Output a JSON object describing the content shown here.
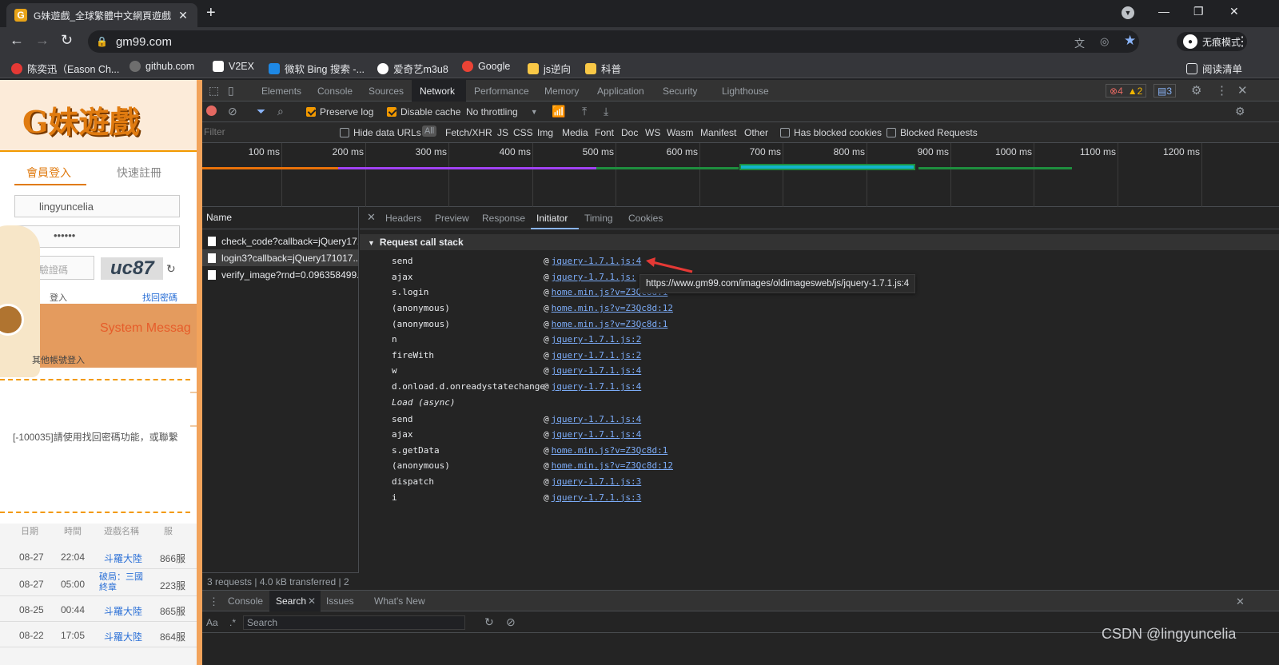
{
  "browser": {
    "tab_title": "G妹遊戲_全球繁體中文網頁遊戲",
    "tab_favicon": "G",
    "url": "gm99.com",
    "incognito_label": "无痕模式",
    "bookmarks": [
      {
        "label": "陈奕迅（Eason Ch...",
        "color": "#e53935"
      },
      {
        "label": "github.com",
        "color": "#6e6e6e"
      },
      {
        "label": "V2EX",
        "color": "#ffffff"
      },
      {
        "label": "微软 Bing 搜索 -...",
        "color": "#1e88e5"
      },
      {
        "label": "爱奇艺m3u8",
        "color": "#ffffff"
      },
      {
        "label": "Google",
        "color": "#ea4335"
      },
      {
        "label": "js逆向",
        "color": "#f9c846"
      },
      {
        "label": "科普",
        "color": "#f9c846"
      }
    ],
    "reading_list": "阅读清单"
  },
  "site": {
    "logo": "G妹遊戲",
    "login_tab": "會員登入",
    "quick_tab": "快速註冊",
    "username": "lingyuncelia",
    "password": "••••••",
    "captcha_placeholder": "驗證碼",
    "captcha_text": "uc87",
    "remember": "登入",
    "forgot": "找回密碼",
    "dialog_title": "System Messag",
    "other_login": "其他帳號登入",
    "error_msg": "[-100035]請使用找回密碼功能，或聯繫",
    "table_headers": [
      "日期",
      "時間",
      "遊戲名稱",
      "服"
    ],
    "table_rows": [
      [
        "08-27",
        "22:04",
        "斗羅大陸",
        "866服"
      ],
      [
        "08-27",
        "05:00",
        "破局：三國終章",
        "223服"
      ],
      [
        "08-25",
        "00:44",
        "斗羅大陸",
        "865服"
      ],
      [
        "08-22",
        "17:05",
        "斗羅大陸",
        "864服"
      ]
    ]
  },
  "devtools": {
    "tabs": [
      "Elements",
      "Console",
      "Sources",
      "Network",
      "Performance",
      "Memory",
      "Application",
      "Security",
      "Lighthouse"
    ],
    "active_tab": "Network",
    "errors": "4",
    "warnings": "2",
    "messages": "3",
    "toolbar": {
      "preserve_log": "Preserve log",
      "disable_cache": "Disable cache",
      "throttling": "No throttling"
    },
    "filter": {
      "placeholder": "Filter",
      "hide_data_urls": "Hide data URLs",
      "types": [
        "All",
        "Fetch/XHR",
        "JS",
        "CSS",
        "Img",
        "Media",
        "Font",
        "Doc",
        "WS",
        "Wasm",
        "Manifest",
        "Other"
      ],
      "blocked_cookies": "Has blocked cookies",
      "blocked_requests": "Blocked Requests"
    },
    "timeline_ticks": [
      "100 ms",
      "200 ms",
      "300 ms",
      "400 ms",
      "500 ms",
      "600 ms",
      "700 ms",
      "800 ms",
      "900 ms",
      "1000 ms",
      "1100 ms",
      "1200 ms"
    ],
    "name_header": "Name",
    "requests": [
      "check_code?callback=jQuery17...",
      "login3?callback=jQuery171017...",
      "verify_image?rnd=0.096358499..."
    ],
    "status": "3 requests  |  4.0 kB transferred  |  2",
    "detail_tabs": [
      "Headers",
      "Preview",
      "Response",
      "Initiator",
      "Timing",
      "Cookies"
    ],
    "active_detail": "Initiator",
    "call_stack_title": "Request call stack",
    "frames": [
      {
        "fn": "send",
        "loc": "jquery-1.7.1.js:4"
      },
      {
        "fn": "ajax",
        "loc": "jquery-1.7.1.js:"
      },
      {
        "fn": "s.login",
        "loc": "home.min.js?v=Z3Qc8d:1"
      },
      {
        "fn": "(anonymous)",
        "loc": "home.min.js?v=Z3Qc8d:12"
      },
      {
        "fn": "(anonymous)",
        "loc": "home.min.js?v=Z3Qc8d:1"
      },
      {
        "fn": "n",
        "loc": "jquery-1.7.1.js:2"
      },
      {
        "fn": "fireWith",
        "loc": "jquery-1.7.1.js:2"
      },
      {
        "fn": "w",
        "loc": "jquery-1.7.1.js:4"
      },
      {
        "fn": "d.onload.d.onreadystatechange",
        "loc": "jquery-1.7.1.js:4"
      },
      {
        "fn": "Load (async)",
        "loc": "",
        "italic": true
      },
      {
        "fn": "send",
        "loc": "jquery-1.7.1.js:4"
      },
      {
        "fn": "ajax",
        "loc": "jquery-1.7.1.js:4"
      },
      {
        "fn": "s.getData",
        "loc": "home.min.js?v=Z3Qc8d:1"
      },
      {
        "fn": "(anonymous)",
        "loc": "home.min.js?v=Z3Qc8d:12"
      },
      {
        "fn": "dispatch",
        "loc": "jquery-1.7.1.js:3"
      },
      {
        "fn": "i",
        "loc": "jquery-1.7.1.js:3"
      }
    ],
    "tooltip": "https://www.gm99.com/images/oldimagesweb/js/jquery-1.7.1.js:4",
    "drawer_tabs": [
      "Console",
      "Search",
      "Issues",
      "What's New"
    ],
    "search_placeholder": "Search",
    "search_aa": "Aa",
    "search_regex": ".*"
  },
  "watermark": "CSDN @lingyuncelia",
  "colors": {
    "accent_orange": "#f29900",
    "link": "#7cacf8",
    "site_orange": "#f2a35b"
  }
}
